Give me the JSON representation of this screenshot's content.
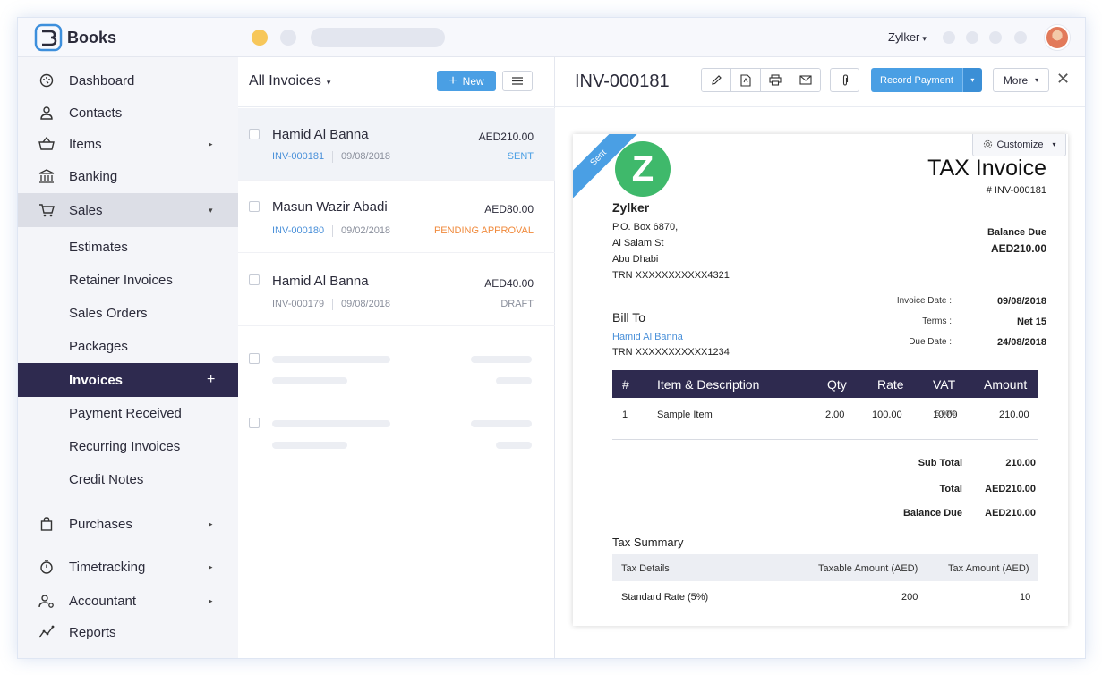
{
  "topbar": {
    "brand": "Books",
    "org": "Zylker",
    "org_caret": "▾"
  },
  "sidebar": {
    "items": [
      {
        "label": "Dashboard",
        "icon": "dashboard-icon"
      },
      {
        "label": "Contacts",
        "icon": "user-icon"
      },
      {
        "label": "Items",
        "icon": "basket-icon"
      },
      {
        "label": "Banking",
        "icon": "bank-icon"
      },
      {
        "label": "Sales",
        "icon": "cart-icon"
      },
      {
        "label": "Estimates"
      },
      {
        "label": "Retainer Invoices"
      },
      {
        "label": "Sales Orders"
      },
      {
        "label": "Packages"
      },
      {
        "label": "Invoices"
      },
      {
        "label": "Payment Received"
      },
      {
        "label": "Recurring Invoices"
      },
      {
        "label": "Credit Notes"
      },
      {
        "label": "Purchases",
        "icon": "bag-icon"
      },
      {
        "label": "Timetracking",
        "icon": "stopwatch-icon"
      },
      {
        "label": "Accountant",
        "icon": "accountant-icon"
      },
      {
        "label": "Reports",
        "icon": "reports-icon"
      }
    ],
    "arrow_right": "▸",
    "arrow_down": "▾",
    "plus": "+"
  },
  "list": {
    "title": "All Invoices",
    "title_caret": "▾",
    "new_label": "New",
    "new_plus": "+",
    "invoices": [
      {
        "customer": "Hamid Al Banna",
        "amount": "AED210.00",
        "number": "INV-000181",
        "date": "09/08/2018",
        "status": "SENT",
        "status_color": "#4a9fe4"
      },
      {
        "customer": "Masun Wazir Abadi",
        "amount": "AED80.00",
        "number": "INV-000180",
        "date": "09/02/2018",
        "status": "PENDING APPROVAL",
        "status_color": "#f08a3c"
      },
      {
        "customer": "Hamid Al Banna",
        "amount": "AED40.00",
        "number": "INV-000179",
        "date": "09/08/2018",
        "status": "DRAFT",
        "status_color": "#8a8f9c"
      }
    ]
  },
  "detail": {
    "title": "INV-000181",
    "record_payment": "Record Payment",
    "record_caret": "▾",
    "more": "More",
    "more_caret": "▾",
    "close": "✕",
    "customize": "Customize",
    "customize_caret": "▾",
    "ribbon": "Sent",
    "logo_letter": "Z",
    "doc_title": "TAX Invoice",
    "doc_number": "# INV-000181",
    "org_name": "Zylker",
    "address": [
      "P.O. Box 6870,",
      "Al Salam St",
      "Abu Dhabi",
      "TRN XXXXXXXXXXX4321"
    ],
    "balance_due_label": "Balance Due",
    "balance_due_value": "AED210.00",
    "meta": [
      {
        "label": "Invoice Date :",
        "value": "09/08/2018"
      },
      {
        "label": "Terms :",
        "value": "Net 15"
      },
      {
        "label": "Due Date :",
        "value": "24/08/2018"
      }
    ],
    "bill_to_label": "Bill To",
    "bill_to_name": "Hamid Al Banna",
    "bill_to_trn": "TRN XXXXXXXXXXX1234",
    "columns": {
      "num": "#",
      "desc": "Item & Description",
      "qty": "Qty",
      "rate": "Rate",
      "vat": "VAT",
      "amount": "Amount"
    },
    "line_items": [
      {
        "num": "1",
        "desc": "Sample Item",
        "qty": "2.00",
        "rate": "100.00",
        "vat": "10.00",
        "vat_pct": "5.00%",
        "amount": "210.00"
      }
    ],
    "totals": [
      {
        "label": "Sub Total",
        "value": "210.00"
      },
      {
        "label": "Total",
        "value": "AED210.00"
      },
      {
        "label": "Balance Due",
        "value": "AED210.00"
      }
    ],
    "tax_summary_label": "Tax Summary",
    "tax_columns": {
      "details": "Tax Details",
      "taxable": "Taxable Amount (AED)",
      "tax": "Tax Amount (AED)"
    },
    "tax_rows": [
      {
        "details": "Standard Rate (5%)",
        "taxable": "200",
        "tax": "10"
      }
    ]
  }
}
